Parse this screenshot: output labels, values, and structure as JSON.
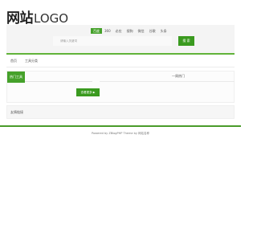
{
  "logo": {
    "cn": "网站",
    "en": "LOGO"
  },
  "search": {
    "tabs": [
      "百度",
      "360",
      "必应",
      "搜狗",
      "微信",
      "谷歌",
      "头条"
    ],
    "placeholder": "请输入关键词",
    "button_label": "搜 索"
  },
  "nav": {
    "items": [
      "首页",
      "工具分类"
    ]
  },
  "hot": {
    "tools_label": "热门工具",
    "popular_label": "一周热门",
    "view_more_label": "查看更多 ▶"
  },
  "links": {
    "label": "友情链接"
  },
  "footer": {
    "text": "Powered by ZBlogPHP Theme by 网站名称"
  },
  "colors": {
    "accent": "#45a12a",
    "button": "#3a9a1f"
  }
}
